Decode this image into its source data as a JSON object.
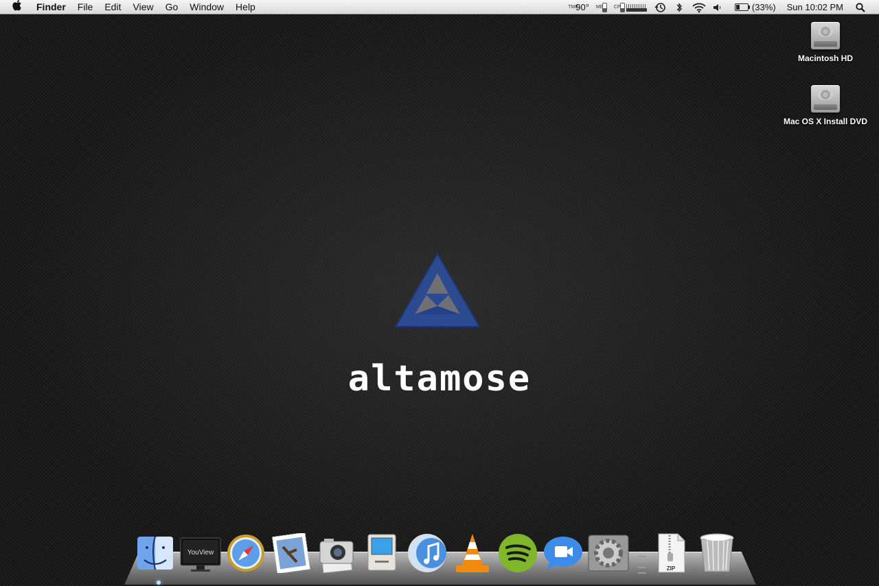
{
  "menubar": {
    "app_name": "Finder",
    "items": [
      "File",
      "Edit",
      "View",
      "Go",
      "Window",
      "Help"
    ],
    "status": {
      "tmp_label": "TMP",
      "temperature": "90°",
      "mem_label": "MEM",
      "cpu_label": "CPU",
      "battery": "(33%)",
      "clock": "Sun 10:02 PM"
    }
  },
  "desktop": {
    "icons": [
      {
        "label": "Macintosh HD",
        "icon": "hard-drive-icon"
      },
      {
        "label": "Mac OS X Install DVD",
        "icon": "hard-drive-icon"
      }
    ],
    "wallpaper": {
      "logo_text": "altamose",
      "triangle_color": "#2b4a8f"
    }
  },
  "dock": {
    "items": [
      {
        "name": "finder",
        "icon": "finder-icon"
      },
      {
        "name": "youview",
        "icon": "youview-icon",
        "label": "YouView"
      },
      {
        "name": "safari",
        "icon": "safari-icon"
      },
      {
        "name": "mail",
        "icon": "mail-icon"
      },
      {
        "name": "image-capture",
        "icon": "camera-icon"
      },
      {
        "name": "classic-mac",
        "icon": "classic-mac-icon"
      },
      {
        "name": "itunes",
        "icon": "itunes-icon"
      },
      {
        "name": "vlc",
        "icon": "vlc-icon"
      },
      {
        "name": "spotify",
        "icon": "spotify-icon"
      },
      {
        "name": "facetime",
        "icon": "facetime-icon"
      },
      {
        "name": "system-preferences",
        "icon": "gear-icon"
      }
    ],
    "stack_items": [
      {
        "name": "zip-archive",
        "icon": "zip-icon",
        "label": "ZIP"
      },
      {
        "name": "trash",
        "icon": "trash-icon"
      }
    ]
  }
}
